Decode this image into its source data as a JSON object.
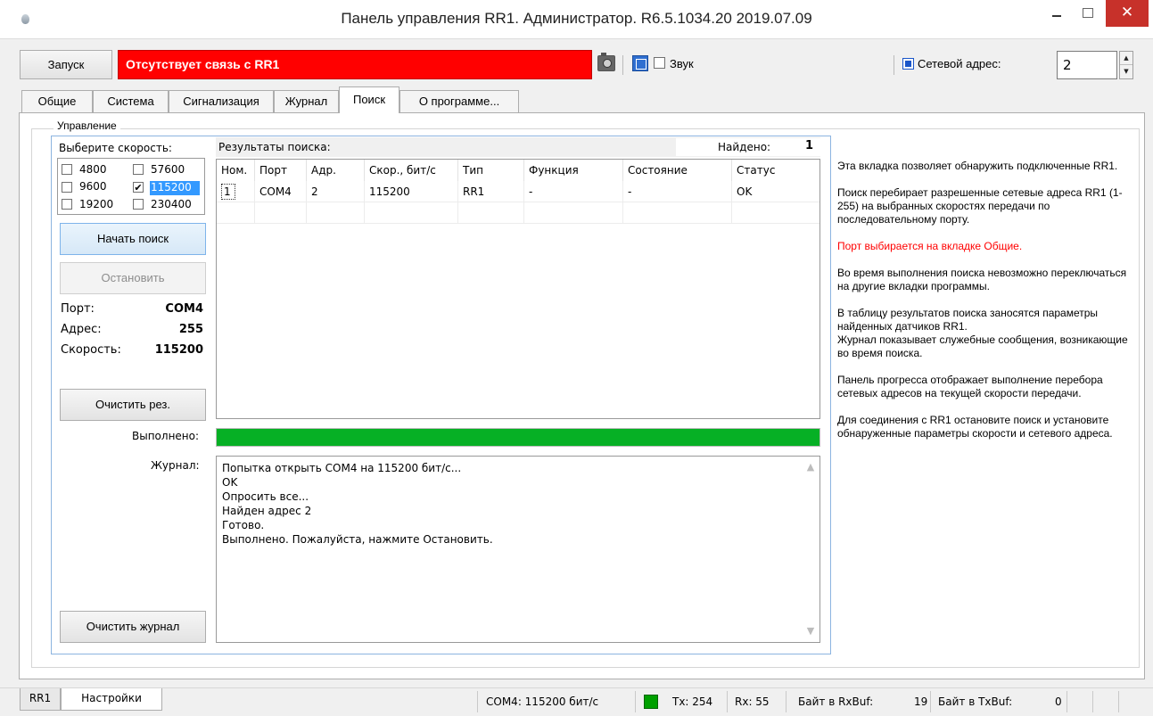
{
  "window": {
    "title": "Панель управления RR1. Администратор. R6.5.1034.20 2019.07.09",
    "min": "‒",
    "close": "✕"
  },
  "toolbar": {
    "run_label": "Запуск",
    "status_text": "Отсутствует связь с RR1",
    "sound_label": "Звук",
    "net_addr_label": "Сетевой адрес:",
    "net_addr_value": "2",
    "spin_up": "▲",
    "spin_down": "▼"
  },
  "tabs": [
    "Общие",
    "Система",
    "Сигнализация",
    "Журнал",
    "Поиск",
    "О программе..."
  ],
  "active_tab": "Поиск",
  "group_title": "Управление",
  "speed": {
    "label": "Выберите скорость:",
    "options": [
      {
        "value": "4800",
        "checked": false
      },
      {
        "value": "57600",
        "checked": false
      },
      {
        "value": "9600",
        "checked": false
      },
      {
        "value": "115200",
        "checked": true
      },
      {
        "value": "19200",
        "checked": false
      },
      {
        "value": "230400",
        "checked": false
      }
    ],
    "check_mark": "✔"
  },
  "buttons": {
    "start_search": "Начать поиск",
    "stop": "Остановить",
    "clear_results": "Очистить рез.",
    "clear_log": "Очистить журнал"
  },
  "info": {
    "port_label": "Порт:",
    "port_value": "COM4",
    "addr_label": "Адрес:",
    "addr_value": "255",
    "speed_label": "Скорость:",
    "speed_value": "115200"
  },
  "results": {
    "label": "Результаты поиска:",
    "found_label": "Найдено:",
    "found_value": "1",
    "columns": [
      "Ном.",
      "Порт",
      "Адр.",
      "Скор., бит/с",
      "Тип",
      "Функция",
      "Состояние",
      "Статус"
    ],
    "rows": [
      [
        "1",
        "COM4",
        "2",
        "115200",
        "RR1",
        "-",
        "-",
        "OK"
      ]
    ]
  },
  "progress": {
    "label": "Выполнено:",
    "value": 1.0,
    "color": "#06b025"
  },
  "log": {
    "label": "Журнал:",
    "lines": [
      "Попытка открыть COM4 на 115200 бит/с...",
      "OK",
      "Опросить все...",
      "Найден адрес 2",
      "Готово.",
      "Выполнено. Пожалуйста, нажмите Остановить."
    ],
    "scroll_up": "▲",
    "scroll_down": "▼"
  },
  "help": {
    "p1": "Эта вкладка позволяет обнаружить подключенные RR1.",
    "p2": "Поиск перебирает разрешенные сетевые адреса RR1 (1-255) на выбранных скоростях передачи по последовательному порту.",
    "p3": "Порт выбирается на вкладке Общие.",
    "p4": "Во время выполнения поиска невозможно переключаться на другие вкладки программы.",
    "p5": "В таблицу результатов поиска заносятся параметры найденных датчиков RR1.",
    "p6": "Журнал показывает служебные сообщения, возникающие во время поиска.",
    "p7": "Панель прогресса отображает выполнение перебора сетевых адресов на текущей скорости передачи.",
    "p8": "Для соединения с RR1 остановите поиск и установите обнаруженные параметры скорости и сетевого адреса."
  },
  "statusbar": {
    "tab1": "RR1",
    "tab2": "Настройки",
    "port_info": "COM4: 115200 бит/с",
    "tx": "Tx: 254",
    "rx": "Rx: 55",
    "rxbuf_label": "Байт в RxBuf:",
    "rxbuf_value": "19",
    "txbuf_label": "Байт в TxBuf:",
    "txbuf_value": "0"
  },
  "colors": {
    "status_banner": "#ff0000",
    "accent": "#3399ff",
    "help_red": "#ff0000",
    "led": "#00a000"
  }
}
